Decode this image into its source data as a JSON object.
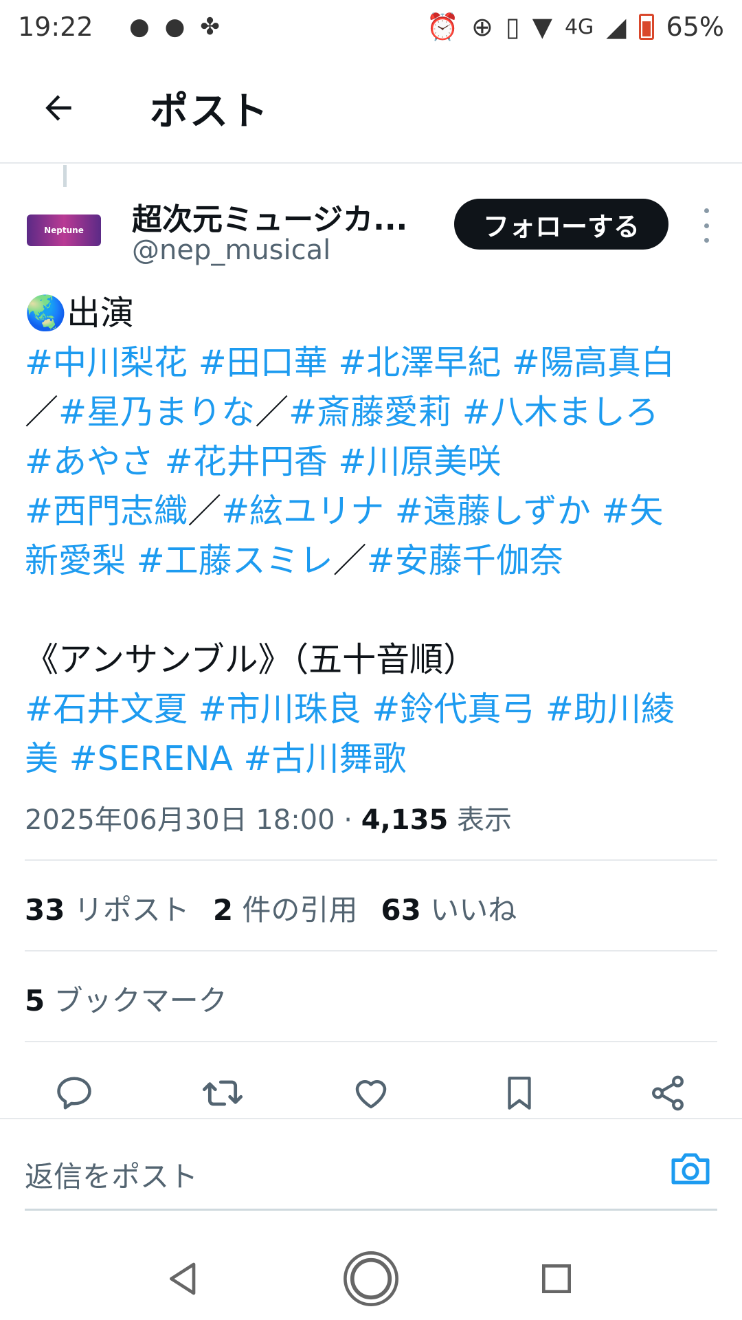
{
  "status_bar": {
    "time": "19:22",
    "battery": "65%",
    "network": "4G"
  },
  "header": {
    "title": "ポスト"
  },
  "tweet": {
    "author": {
      "display_name": "超次元ミュージカ...",
      "handle": "@nep_musical",
      "follow_label": "フォローする"
    },
    "body_lines": [
      [
        {
          "t": "🌏出演",
          "tag": false
        }
      ],
      [
        {
          "t": "#中川梨花 #田口華 #北澤早紀 #陽高真白",
          "tag": true
        }
      ],
      [
        {
          "t": "／",
          "tag": false
        },
        {
          "t": "#星乃まりな",
          "tag": true
        },
        {
          "t": "／",
          "tag": false
        },
        {
          "t": "#斎藤愛莉 #八木ましろ",
          "tag": true
        }
      ],
      [
        {
          "t": "#あやさ #花井円香 #川原美咲",
          "tag": true
        }
      ],
      [
        {
          "t": "#西門志織",
          "tag": true
        },
        {
          "t": "／",
          "tag": false
        },
        {
          "t": "#絃ユリナ #遠藤しずか #矢",
          "tag": true
        }
      ],
      [
        {
          "t": "新愛梨 #工藤スミレ",
          "tag": true
        },
        {
          "t": "／",
          "tag": false
        },
        {
          "t": "#安藤千伽奈",
          "tag": true
        }
      ],
      [],
      [
        {
          "t": "《アンサンブル》（五十音順）",
          "tag": false
        }
      ],
      [
        {
          "t": "#石井文夏 #市川珠良 #鈴代真弓 #助川綾",
          "tag": true
        }
      ],
      [
        {
          "t": "美 #SERENA #古川舞歌",
          "tag": true
        }
      ]
    ],
    "timestamp": "2025年06月30日 18:00",
    "separator": " · ",
    "views_count": "4,135",
    "views_label": " 表示",
    "reposts_count": "33",
    "reposts_label": " リポスト",
    "quotes_count": "2",
    "quotes_label": " 件の引用",
    "likes_count": "63",
    "likes_label": " いいね",
    "bookmarks_count": "5",
    "bookmarks_label": " ブックマーク"
  },
  "reply_bar": {
    "placeholder": "返信をポスト"
  },
  "colors": {
    "hashtag": "#1d9bf0",
    "text": "#0f1419",
    "muted": "#536471"
  },
  "icons": [
    "back-arrow-icon",
    "reply-icon",
    "repost-icon",
    "like-icon",
    "bookmark-icon",
    "share-icon",
    "camera-icon",
    "nav-back-icon",
    "nav-home-icon",
    "nav-recents-icon"
  ]
}
